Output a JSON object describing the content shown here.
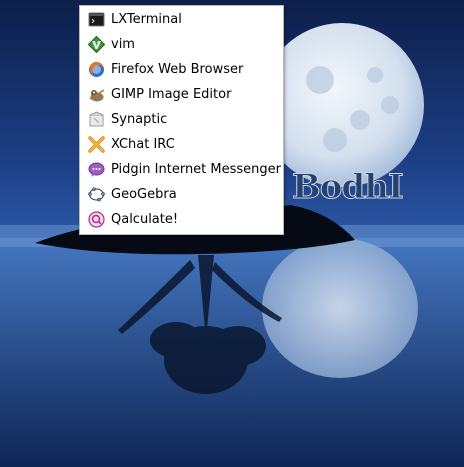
{
  "desktop": {
    "wallpaper_text": "BodhI",
    "sky_color": "#1e3f86",
    "moon_color": "#d7e3f2"
  },
  "menu": {
    "items": [
      {
        "label": "LXTerminal",
        "icon": "terminal-icon"
      },
      {
        "label": "vim",
        "icon": "vim-icon"
      },
      {
        "label": "Firefox Web Browser",
        "icon": "firefox-icon"
      },
      {
        "label": "GIMP Image Editor",
        "icon": "gimp-icon"
      },
      {
        "label": "Synaptic",
        "icon": "synaptic-icon"
      },
      {
        "label": "XChat IRC",
        "icon": "xchat-icon"
      },
      {
        "label": "Pidgin Internet Messenger",
        "icon": "pidgin-icon"
      },
      {
        "label": "GeoGebra",
        "icon": "geogebra-icon"
      },
      {
        "label": "Qalculate!",
        "icon": "qalculate-icon"
      }
    ]
  }
}
